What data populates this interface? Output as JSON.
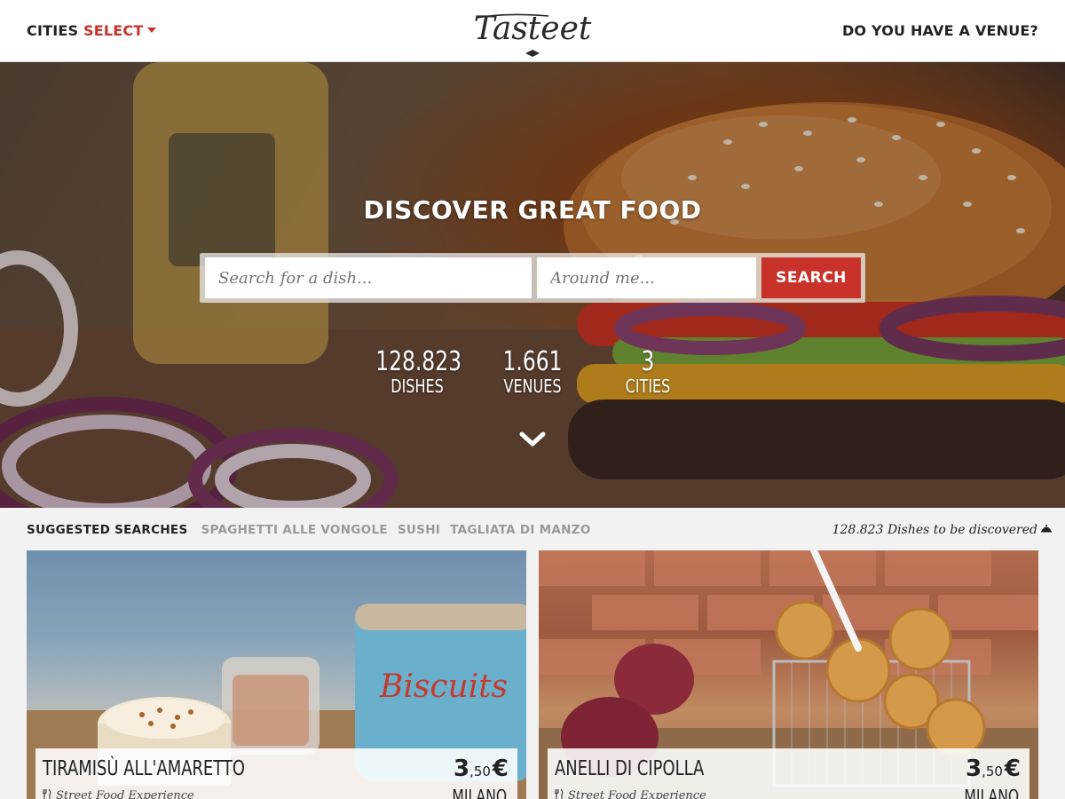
{
  "header": {
    "cities_label": "CITIES",
    "cities_select": "SELECT",
    "logo_text": "Tasteet",
    "venue_link": "DO YOU HAVE A VENUE?"
  },
  "hero": {
    "title": "DISCOVER GREAT FOOD",
    "search": {
      "dish_placeholder": "Search for a dish...",
      "location_placeholder": "Around me...",
      "button_label": "SEARCH"
    },
    "stats": [
      {
        "value": "128.823",
        "label": "DISHES"
      },
      {
        "value": "1.661",
        "label": "VENUES"
      },
      {
        "value": "3",
        "label": "CITIES"
      }
    ]
  },
  "suggested": {
    "title": "SUGGESTED SEARCHES",
    "items": [
      "SPAGHETTI ALLE VONGOLE",
      "SUSHI",
      "TAGLIATA DI MANZO"
    ],
    "discovered_text": "128.823 Dishes to be discovered"
  },
  "cards": [
    {
      "name": "TIRAMISÙ ALL'AMARETTO",
      "price_int": "3",
      "price_dec": ",50",
      "currency": "€",
      "city": "MILANO",
      "venue": "Street Food Experience"
    },
    {
      "name": "ANELLI DI CIPOLLA",
      "price_int": "3",
      "price_dec": ",50",
      "currency": "€",
      "city": "MILANO",
      "venue": "Street Food Experience"
    }
  ],
  "colors": {
    "accent": "#c8322a",
    "text": "#222222",
    "muted": "#999999"
  }
}
